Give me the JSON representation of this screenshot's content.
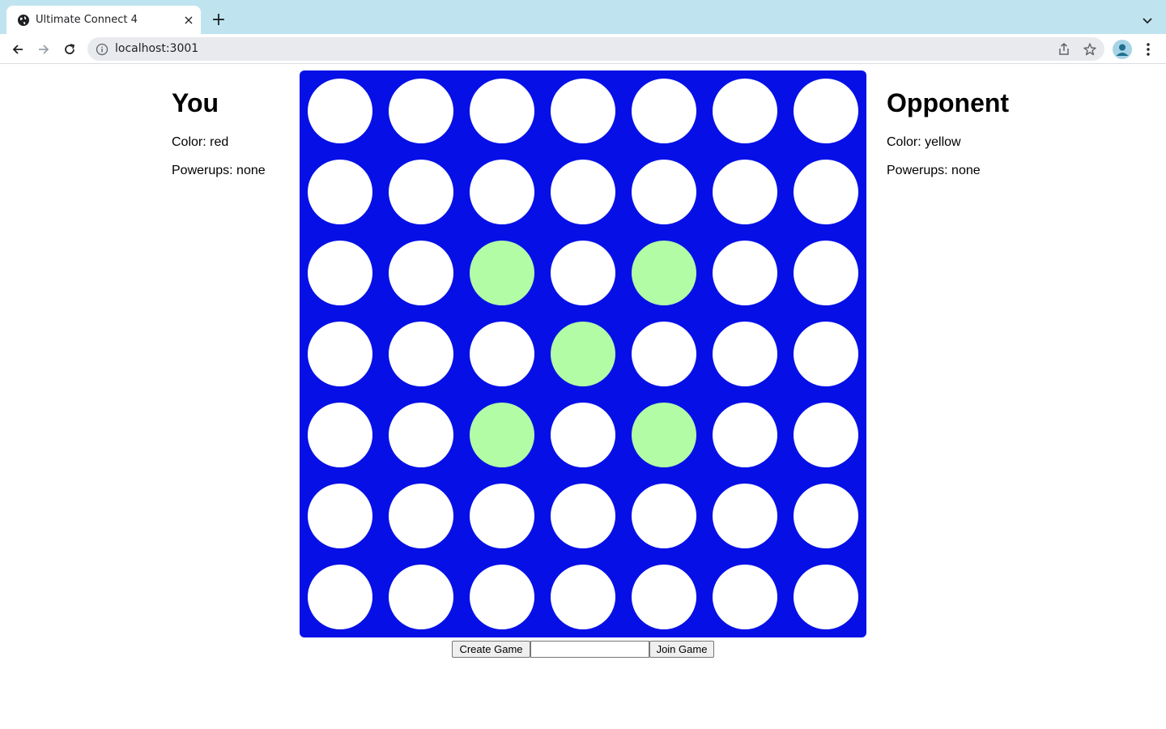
{
  "browser": {
    "tab_title": "Ultimate Connect 4",
    "tab_close": "×",
    "new_tab": "+",
    "url": "localhost:3001",
    "tabbar_color": "#bfe4f0"
  },
  "you": {
    "heading": "You",
    "color_line": "Color: red",
    "powerups_line": "Powerups: none"
  },
  "opponent": {
    "heading": "Opponent",
    "color_line": "Color: yellow",
    "powerups_line": "Powerups: none"
  },
  "board": {
    "rows": 7,
    "cols": 7,
    "board_color": "#0610e6",
    "empty_color": "#ffffff",
    "highlight_color": "#b1fca5",
    "highlighted_cells": [
      [
        2,
        2
      ],
      [
        2,
        4
      ],
      [
        3,
        3
      ],
      [
        4,
        2
      ],
      [
        4,
        4
      ]
    ]
  },
  "controls": {
    "create_label": "Create Game",
    "join_label": "Join Game",
    "game_id_value": ""
  }
}
